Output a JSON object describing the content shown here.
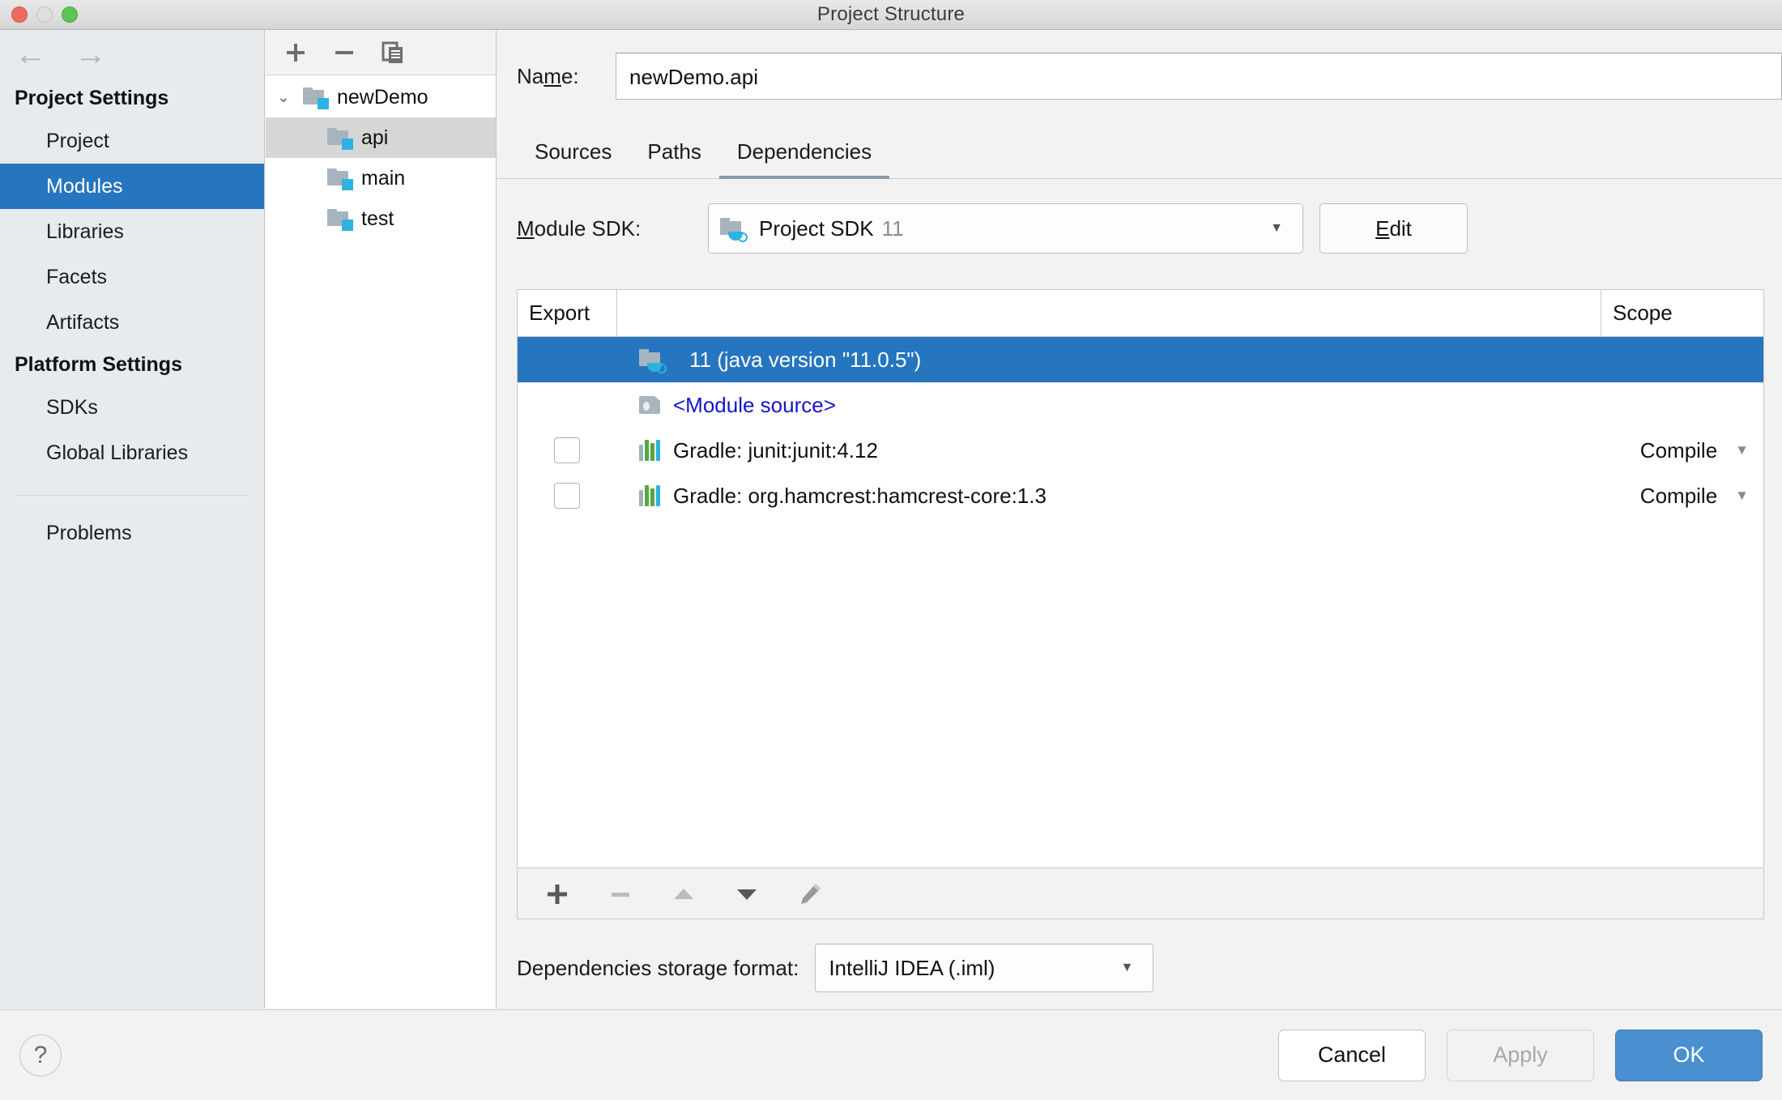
{
  "window": {
    "title": "Project Structure",
    "traffic_lights": [
      "close-button",
      "minimize-button",
      "maximize-button"
    ]
  },
  "nav": {
    "back_icon": "←",
    "forward_icon": "→"
  },
  "sidebar": {
    "groups": [
      {
        "label": "Project Settings",
        "items": [
          {
            "label": "Project",
            "selected": false
          },
          {
            "label": "Modules",
            "selected": true
          },
          {
            "label": "Libraries",
            "selected": false
          },
          {
            "label": "Facets",
            "selected": false
          },
          {
            "label": "Artifacts",
            "selected": false
          }
        ]
      },
      {
        "label": "Platform Settings",
        "items": [
          {
            "label": "SDKs",
            "selected": false
          },
          {
            "label": "Global Libraries",
            "selected": false
          }
        ]
      }
    ],
    "problems": {
      "label": "Problems"
    }
  },
  "tree": {
    "toolbar": [
      {
        "name": "add-module-button",
        "glyph": "+"
      },
      {
        "name": "remove-module-button",
        "glyph": "−"
      },
      {
        "name": "copy-module-button",
        "glyph": "copy"
      }
    ],
    "root": {
      "label": "newDemo",
      "expanded": true,
      "chevron": "⌄"
    },
    "children": [
      {
        "label": "api",
        "selected": true
      },
      {
        "label": "main",
        "selected": false
      },
      {
        "label": "test",
        "selected": false
      }
    ]
  },
  "main": {
    "name_field": {
      "label_pre": "Na",
      "label_mnemonic": "m",
      "label_post": "e:",
      "value": "newDemo.api",
      "placeholder": ""
    },
    "tabs": [
      {
        "label": "Sources",
        "active": false
      },
      {
        "label": "Paths",
        "active": false
      },
      {
        "label": "Dependencies",
        "active": true
      }
    ],
    "module_sdk": {
      "label_mnemonic": "M",
      "label_rest": "odule SDK:",
      "value": "Project SDK",
      "version": "11",
      "caret": "▼",
      "edit_button": {
        "pre": "",
        "mnemonic": "E",
        "post": "dit"
      }
    },
    "dependencies_table": {
      "columns": [
        "Export",
        "",
        "Scope"
      ],
      "rows": [
        {
          "export_checkbox": null,
          "icon": "jdk-icon",
          "name": "11 (java version \"11.0.5\")",
          "scope": "",
          "selected": true,
          "link": false
        },
        {
          "export_checkbox": null,
          "icon": "module-source-icon",
          "name": "<Module source>",
          "scope": "",
          "selected": false,
          "link": true
        },
        {
          "export_checkbox": false,
          "icon": "library-icon",
          "name": "Gradle: junit:junit:4.12",
          "scope": "Compile",
          "selected": false,
          "link": false
        },
        {
          "export_checkbox": false,
          "icon": "library-icon",
          "name": "Gradle: org.hamcrest:hamcrest-core:1.3",
          "scope": "Compile",
          "selected": false,
          "link": false
        }
      ],
      "scope_caret": "▼"
    },
    "list_toolbar": [
      {
        "name": "add-dependency-button",
        "glyph": "+",
        "enabled": true
      },
      {
        "name": "remove-dependency-button",
        "glyph": "−",
        "enabled": false
      },
      {
        "name": "move-up-button",
        "glyph": "▲",
        "enabled": false
      },
      {
        "name": "move-down-button",
        "glyph": "▼",
        "enabled": true
      },
      {
        "name": "edit-dependency-button",
        "glyph": "✎",
        "enabled": true
      }
    ],
    "storage": {
      "label": "Dependencies storage format:",
      "value": "IntelliJ IDEA (.iml)",
      "caret": "▼"
    }
  },
  "footer": {
    "help_glyph": "?",
    "buttons": [
      {
        "label": "Cancel",
        "kind": "cancel",
        "enabled": true
      },
      {
        "label": "Apply",
        "kind": "apply",
        "enabled": false
      },
      {
        "label": "OK",
        "kind": "primary",
        "enabled": true
      }
    ]
  },
  "colors": {
    "selection_blue": "#2675bf",
    "primary_button": "#4a8fd0",
    "sidebar_bg": "#e7ebee",
    "link_blue": "#1414d0",
    "badge_cyan": "#2eb3e0"
  }
}
